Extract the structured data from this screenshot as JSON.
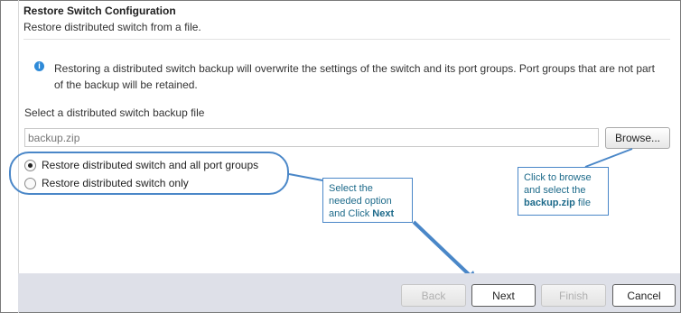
{
  "dialog": {
    "title": "Restore Switch Configuration",
    "subtitle": "Restore distributed switch from a file."
  },
  "info": {
    "icon": "info-icon",
    "text": "Restoring a distributed switch backup will overwrite the settings of the switch and its port groups. Port groups that are not part of the backup will be retained."
  },
  "file_select": {
    "label": "Select a distributed switch backup file",
    "placeholder": "backup.zip",
    "browse_label": "Browse..."
  },
  "options": [
    {
      "label": "Restore distributed switch and all port groups",
      "selected": true
    },
    {
      "label": "Restore distributed switch only",
      "selected": false
    }
  ],
  "callouts": {
    "option": {
      "line1": "Select the",
      "line2": "needed option",
      "line3_prefix": "and Click ",
      "line3_bold": "Next"
    },
    "browse": {
      "line1": "Click to browse",
      "line2": "and  select the",
      "line3_bold": "backup.zip",
      "line3_suffix": " file"
    }
  },
  "footer": {
    "back_label": "Back",
    "next_label": "Next",
    "finish_label": "Finish",
    "cancel_label": "Cancel"
  },
  "colors": {
    "annotation_blue": "#4a87c8",
    "callout_text": "#1d6a8a",
    "footer_bg": "#dee0e8"
  }
}
